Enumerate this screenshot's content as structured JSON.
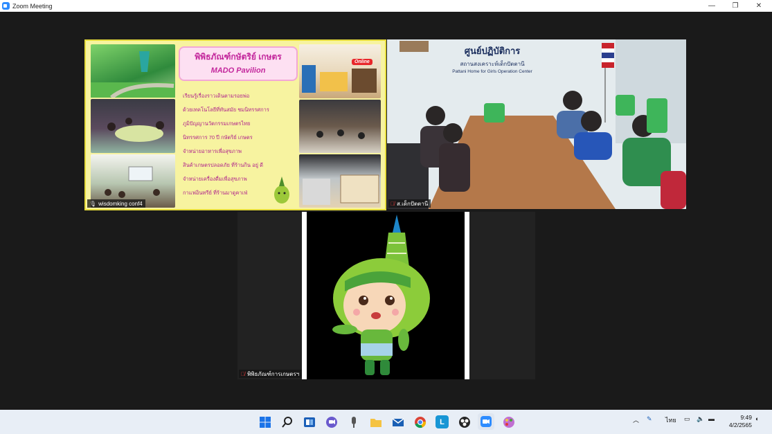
{
  "window": {
    "title": "Zoom Meeting",
    "controls": [
      "minimize",
      "restore",
      "close"
    ]
  },
  "participants": [
    {
      "name": "wisdomking conf4",
      "muted": false,
      "poster": {
        "title": "พิพิธภัณฑ์กษัตริย์ เกษตร",
        "subtitle": "MADO Pavilion",
        "lines": [
          "เรียนรู้เรื่องราวเดินตามรอยพ่อ",
          "ด้วยเทคโนโลยีที่ทันสมัย ชมนิทรรศการ",
          "ภูมิปัญญานวัตกรรมเกษตรไทย",
          "นิทรรศการ 70 ปี กษัตริย์ เกษตร",
          "จำหน่ายอาหารเพื่อสุขภาพ",
          "สินค้าเกษตรปลอดภัย ที่ร้านกิน อยู่ ดี",
          "จำหน่ายเครื่องดื่มเพื่อสุขภาพ",
          "กาแฟอินทรีย์ ที่ร้านมาดูคาเฟ่"
        ],
        "badge": "Online"
      }
    },
    {
      "name": "ส.เด็กปัตตานี",
      "muted": true,
      "sign": {
        "title": "ศูนย์ปฏิบัติการ",
        "line1": "สถานสงเคราะห์เด็กปัตตานี",
        "line2": "Pattani Home for Girls Operation Center"
      }
    },
    {
      "name": "พิพิธภัณฑ์การเกษตรฯ",
      "muted": true
    }
  ],
  "taskbar": {
    "apps": [
      "start-icon",
      "search-icon",
      "widgets-icon",
      "chat-icon",
      "microphone-app-icon",
      "file-explorer-icon",
      "mail-icon",
      "chrome-icon",
      "l-app-icon",
      "obs-icon",
      "zoom-icon",
      "paint-app-icon"
    ],
    "language": "ไทย",
    "time": "9:49",
    "date": "4/2/2565"
  },
  "colors": {
    "accent": "#2d8cff",
    "muted_mic": "#e03a3a",
    "poster_pink": "#c3279c"
  }
}
